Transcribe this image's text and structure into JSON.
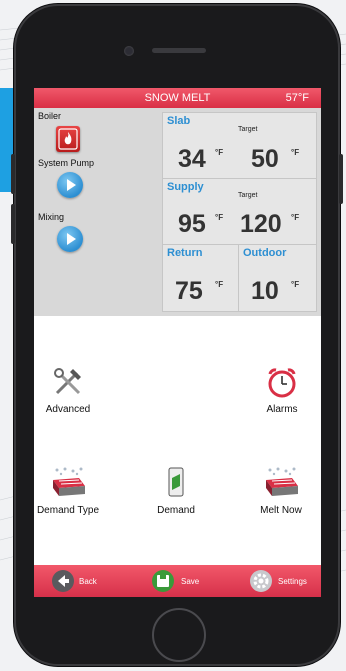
{
  "header": {
    "title": "SNOW MELT",
    "outdoor_temp": "57°F"
  },
  "equipment": {
    "boiler": "Boiler",
    "system_pump": "System Pump",
    "mixing": "Mixing"
  },
  "readings": {
    "slab": {
      "label": "Slab",
      "value": "34",
      "unit": "°F",
      "target_label": "Target",
      "target_value": "50",
      "target_unit": "°F"
    },
    "supply": {
      "label": "Supply",
      "value": "95",
      "unit": "°F",
      "target_label": "Target",
      "target_value": "120",
      "target_unit": "°F"
    },
    "return": {
      "label": "Return",
      "value": "75",
      "unit": "°F"
    },
    "outdoor": {
      "label": "Outdoor",
      "value": "10",
      "unit": "°F"
    }
  },
  "actions": {
    "advanced": "Advanced",
    "alarms": "Alarms",
    "demand_type": "Demand Type",
    "demand": "Demand",
    "melt_now": "Melt Now"
  },
  "toolbar": {
    "back": "Back",
    "save": "Save",
    "settings": "Settings"
  },
  "colors": {
    "accent_red": "#d92f45",
    "accent_blue": "#2d8fd2",
    "panel_gray": "#d8d8d8"
  }
}
